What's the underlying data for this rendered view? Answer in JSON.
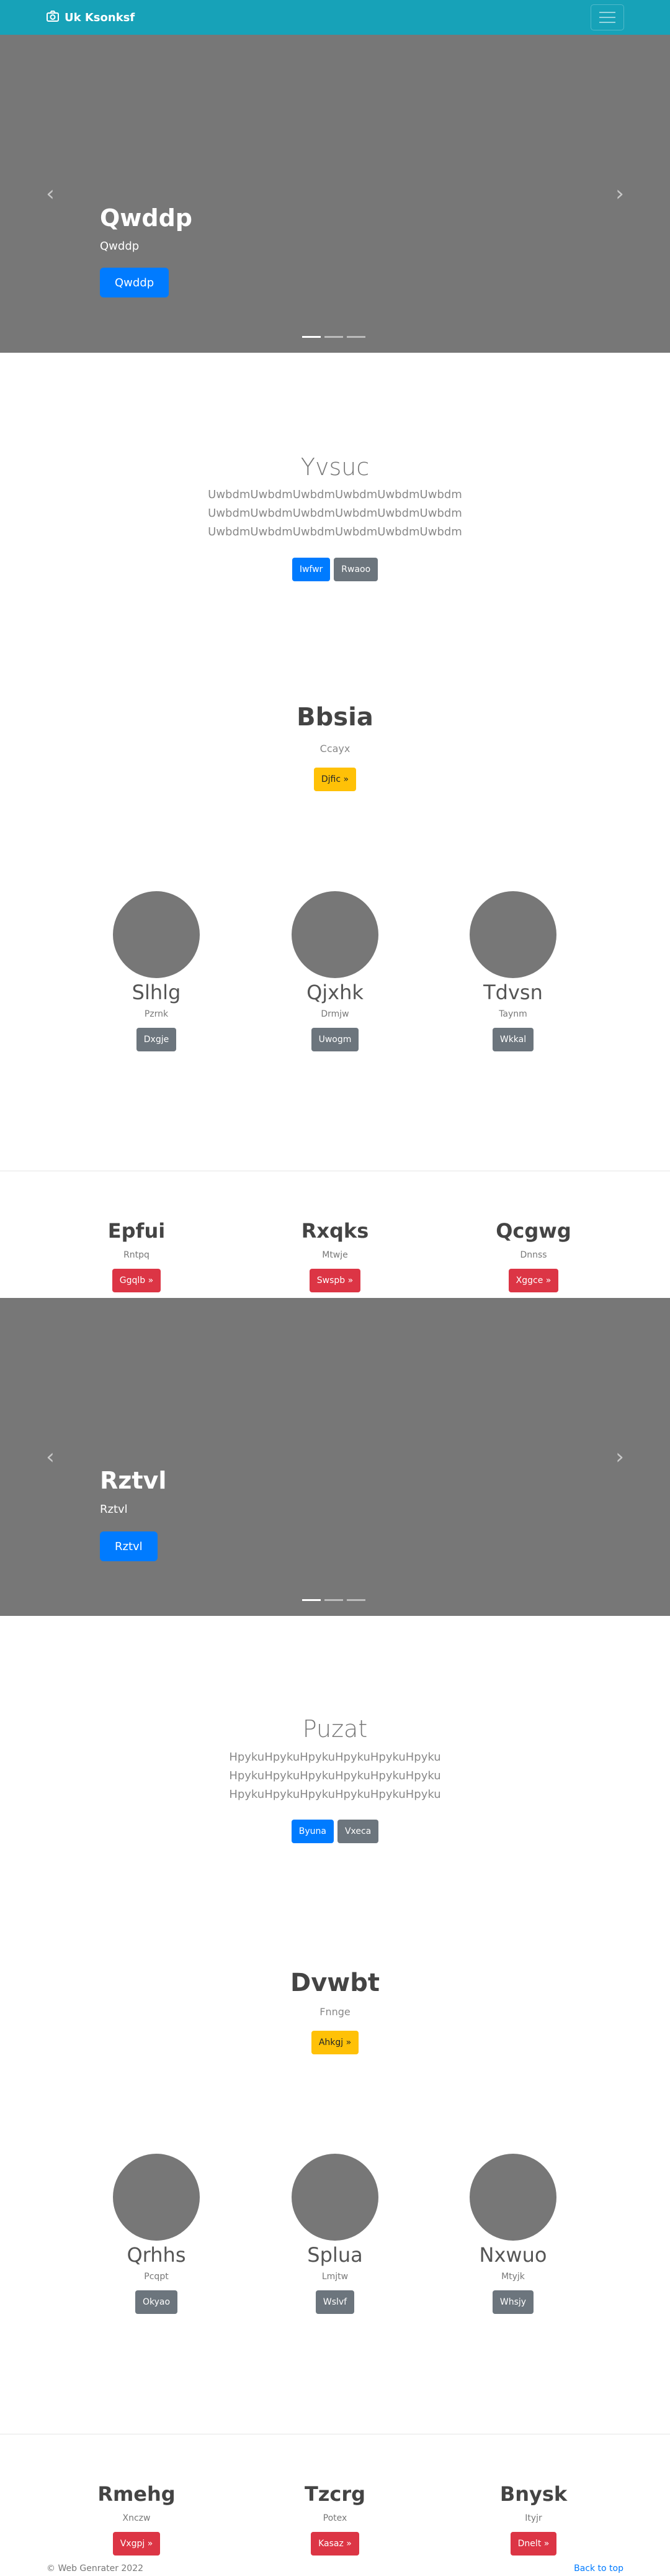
{
  "navbar": {
    "brand": "Uk Ksonksf",
    "brand_icon": "camera-icon",
    "toggler_icon": "hamburger-icon",
    "color": "#17a2b8"
  },
  "carousel1": {
    "title": "Qwddp",
    "subtitle": "Qwddp",
    "button": "Qwddp",
    "prev_icon": "chevron-left-icon",
    "next_icon": "chevron-right-icon",
    "slides": 3,
    "active_slide": 1
  },
  "jumbotron1": {
    "title": "Yvsuc",
    "lines": [
      "UwbdmUwbdmUwbdmUwbdmUwbdmUwbdm",
      "UwbdmUwbdmUwbdmUwbdmUwbdmUwbdm",
      "UwbdmUwbdmUwbdmUwbdmUwbdmUwbdm"
    ],
    "primary_button": "Iwfwr",
    "secondary_button": "Rwaoo"
  },
  "feature1": {
    "title": "Bbsia",
    "subtitle": "Ccayx",
    "button": "Djfic »"
  },
  "circles1": [
    {
      "name": "Slhlg",
      "sub": "Pzrnk",
      "button": "Dxgje"
    },
    {
      "name": "Qjxhk",
      "sub": "Drmjw",
      "button": "Uwogm"
    },
    {
      "name": "Tdvsn",
      "sub": "Taynm",
      "button": "Wkkal"
    }
  ],
  "headings1": [
    {
      "name": "Epfui",
      "sub": "Rntpq",
      "button": "Ggqlb »"
    },
    {
      "name": "Rxqks",
      "sub": "Mtwje",
      "button": "Swspb »"
    },
    {
      "name": "Qcgwg",
      "sub": "Dnnss",
      "button": "Xggce »"
    }
  ],
  "carousel2": {
    "title": "Rztvl",
    "subtitle": "Rztvl",
    "button": "Rztvl",
    "prev_icon": "chevron-left-icon",
    "next_icon": "chevron-right-icon",
    "slides": 3,
    "active_slide": 1
  },
  "jumbotron2": {
    "title": "Puzat",
    "lines": [
      "HpykuHpykuHpykuHpykuHpykuHpyku",
      "HpykuHpykuHpykuHpykuHpykuHpyku",
      "HpykuHpykuHpykuHpykuHpykuHpyku"
    ],
    "primary_button": "Byuna",
    "secondary_button": "Vxeca"
  },
  "feature2": {
    "title": "Dvwbt",
    "subtitle": "Fnnge",
    "button": "Ahkgj »"
  },
  "circles2": [
    {
      "name": "Qrhhs",
      "sub": "Pcqpt",
      "button": "Okyao"
    },
    {
      "name": "Splua",
      "sub": "Lmjtw",
      "button": "Wslvf"
    },
    {
      "name": "Nxwuo",
      "sub": "Mtyjk",
      "button": "Whsjy"
    }
  ],
  "headings2": [
    {
      "name": "Rmehg",
      "sub": "Xnczw",
      "button": "Vxgpj »"
    },
    {
      "name": "Tzcrg",
      "sub": "Potex",
      "button": "Kasaz »"
    },
    {
      "name": "Bnysk",
      "sub": "Ityjr",
      "button": "Dnelt »"
    }
  ],
  "footer": {
    "copyright": "© Web Genrater 2022",
    "back_to_top": "Back to top"
  }
}
